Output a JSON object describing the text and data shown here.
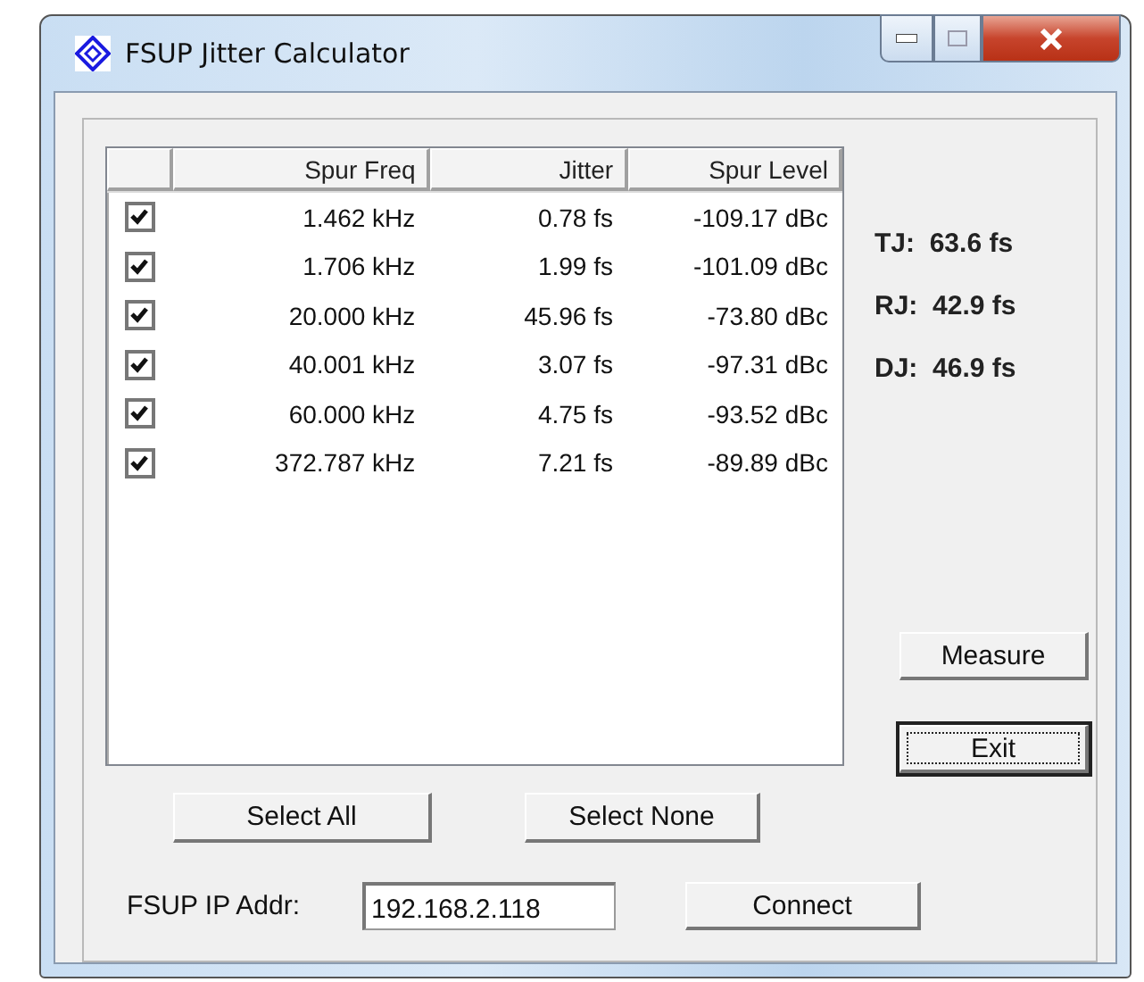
{
  "window": {
    "title": "FSUP Jitter Calculator"
  },
  "table": {
    "columns": [
      "Spur Freq",
      "Jitter",
      "Spur Level"
    ],
    "rows": [
      {
        "checked": true,
        "cells": [
          "1.462 kHz",
          "0.78 fs",
          "-109.17 dBc"
        ]
      },
      {
        "checked": true,
        "cells": [
          "1.706 kHz",
          "1.99 fs",
          "-101.09 dBc"
        ]
      },
      {
        "checked": true,
        "cells": [
          "20.000 kHz",
          "45.96 fs",
          "-73.80 dBc"
        ]
      },
      {
        "checked": true,
        "cells": [
          "40.001 kHz",
          "3.07 fs",
          "-97.31 dBc"
        ]
      },
      {
        "checked": true,
        "cells": [
          "60.000 kHz",
          "4.75 fs",
          "-93.52 dBc"
        ]
      },
      {
        "checked": true,
        "cells": [
          "372.787 kHz",
          "7.21 fs",
          "-89.89 dBc"
        ]
      }
    ]
  },
  "results": [
    {
      "label": "TJ:",
      "value": "63.6 fs"
    },
    {
      "label": "RJ:",
      "value": "42.9 fs"
    },
    {
      "label": "DJ:",
      "value": "46.9 fs"
    }
  ],
  "side_buttons": [
    {
      "label": "Measure",
      "focused": false
    },
    {
      "label": "Exit",
      "focused": true
    }
  ],
  "select_buttons": [
    "Select All",
    "Select None"
  ],
  "connection": {
    "label": "FSUP IP Addr:",
    "value": "192.168.2.118",
    "button": "Connect"
  }
}
